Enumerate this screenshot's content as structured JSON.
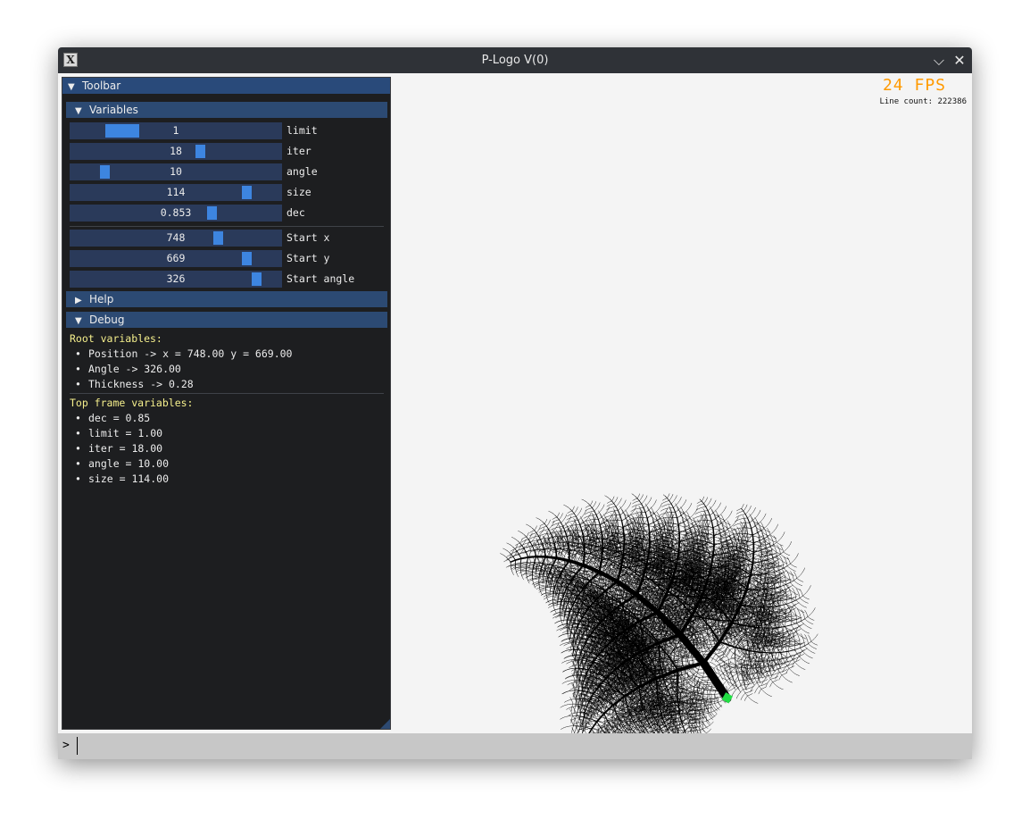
{
  "window": {
    "title": "P-Logo V(0)",
    "app_icon": "x-logo-icon",
    "minimize_glyph": "⌵",
    "close_glyph": "✕"
  },
  "overlay": {
    "fps": "24 FPS",
    "line_count": "Line count: 222386",
    "fps_color": "#ff9a00"
  },
  "toolbar": {
    "title": "Toolbar",
    "variables_header": "Variables",
    "sliders": [
      {
        "label": "limit",
        "value": "1",
        "fraction": 0.2
      },
      {
        "label": "iter",
        "value": "18",
        "fraction": 0.62
      },
      {
        "label": "angle",
        "value": "10",
        "fraction": 0.15
      },
      {
        "label": "size",
        "value": "114",
        "fraction": 0.85
      },
      {
        "label": "dec",
        "value": "0.853",
        "fraction": 0.68
      }
    ],
    "start_sliders": [
      {
        "label": "Start x",
        "value": "748",
        "fraction": 0.71
      },
      {
        "label": "Start y",
        "value": "669",
        "fraction": 0.85
      },
      {
        "label": "Start angle",
        "value": "326",
        "fraction": 0.9
      }
    ],
    "help_header": "Help",
    "debug_header": "Debug",
    "root_title": "Root variables:",
    "root_items": [
      "Position -> x = 748.00 y = 669.00",
      "Angle -> 326.00",
      "Thickness -> 0.28"
    ],
    "top_title": "Top frame variables:",
    "top_items": [
      "dec = 0.85",
      "limit = 1.00",
      "iter = 18.00",
      "angle = 10.00",
      "size = 114.00"
    ]
  },
  "console": {
    "prompt": ">"
  },
  "colors": {
    "panel_bg": "#1d1e20",
    "header_bg": "#2c4a73",
    "slider_bg": "#2a3a5a",
    "slider_grab": "#3d85e0",
    "debug_heading": "#f5ef8c",
    "turtle": "#22dd44"
  }
}
